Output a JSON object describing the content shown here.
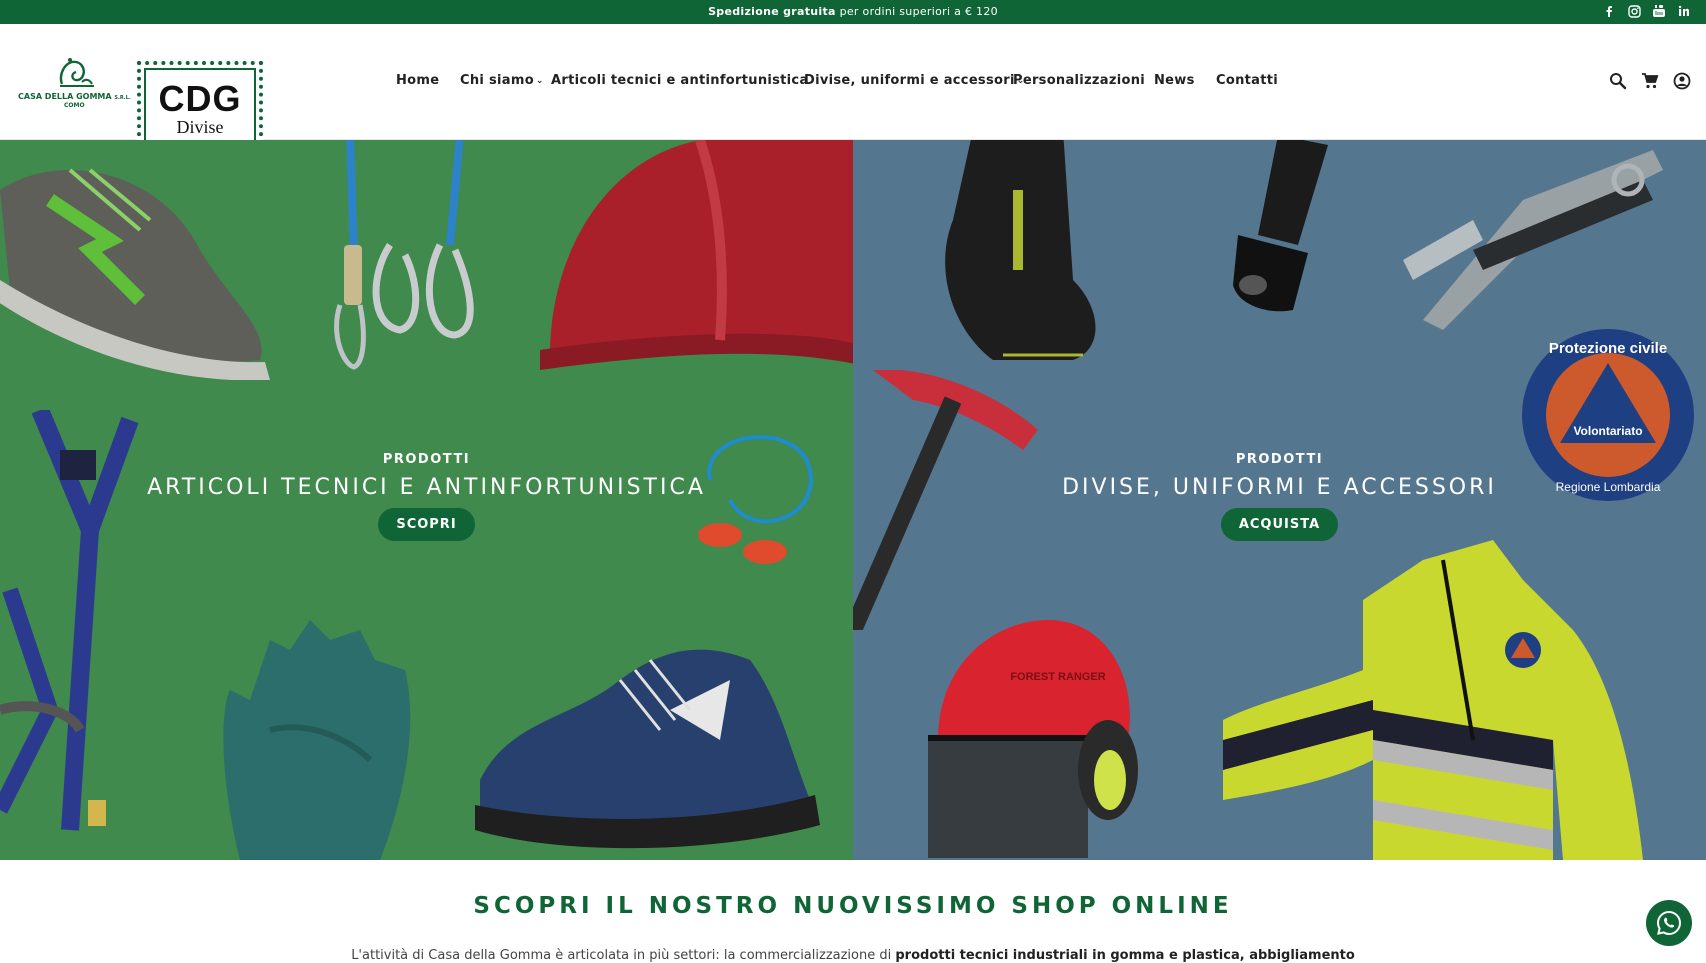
{
  "topbar": {
    "promo_bold": "Spedizione gratuita",
    "promo_rest": "per ordini superiori a € 120",
    "socials": [
      "facebook-icon",
      "instagram-icon",
      "youtube-icon",
      "linkedin-icon"
    ]
  },
  "brand": {
    "casa_line1": "CASA DELLA GOMMA",
    "casa_srl": "S.R.L.",
    "casa_line2": "COMO",
    "cdg_big": "CDG",
    "cdg_small": "Divise"
  },
  "nav": {
    "home": "Home",
    "chi_siamo": "Chi siamo",
    "articoli": "Articoli tecnici e antinfortunistica",
    "divise": "Divise, uniformi e accessori",
    "personalizzazioni": "Personalizzazioni",
    "news": "News",
    "contatti": "Contatti"
  },
  "header_icons": [
    "search-icon",
    "cart-icon",
    "account-icon"
  ],
  "hero": {
    "left": {
      "kicker": "PRODOTTI",
      "title": "ARTICOLI TECNICI E ANTINFORTUNISTICA",
      "button": "SCOPRI"
    },
    "right": {
      "kicker": "PRODOTTI",
      "title": "DIVISE, UNIFORMI E ACCESSORI",
      "button": "ACQUISTA",
      "badge_text_top": "Protezione civile",
      "badge_text_middle": "Volontariato",
      "badge_text_bottom": "Regione Lombardia",
      "helmet_text": "FOREST RANGER"
    }
  },
  "section": {
    "title": "SCOPRI IL NOSTRO NUOVISSIMO SHOP ONLINE",
    "intro_start": "L'attività di Casa della Gomma è articolata in più settori: la commercializzazione di",
    "intro_bold": "prodotti tecnici industriali in gomma e plastica, abbigliamento"
  },
  "colors": {
    "brand_green": "#0f6535",
    "left_panel": "#3f8a4c",
    "right_panel": "#55768f"
  }
}
